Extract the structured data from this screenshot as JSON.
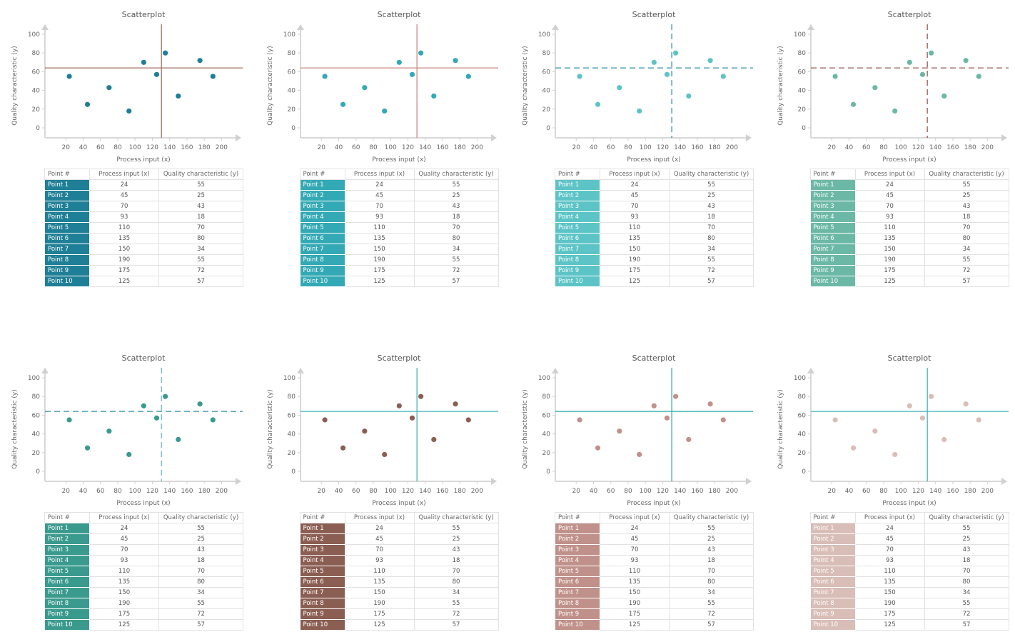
{
  "chart_data": [
    {
      "type": "scatter",
      "title": "Scatterplot",
      "xlabel": "Process input (x)",
      "ylabel": "Quality characteristic (y)",
      "xlim": [
        0,
        220
      ],
      "ylim": [
        -10,
        110
      ],
      "xticks": [
        20,
        40,
        60,
        80,
        100,
        120,
        140,
        160,
        180,
        200
      ],
      "yticks": [
        0,
        20,
        40,
        60,
        80,
        100
      ],
      "reference_lines": {
        "x": 130.5,
        "y": 64,
        "style": "solid"
      },
      "colors": {
        "point": "#1f7f96",
        "line": "#a07060"
      },
      "points": [
        {
          "name": "Point 1",
          "x": 24,
          "y": 55
        },
        {
          "name": "Point 2",
          "x": 45,
          "y": 25
        },
        {
          "name": "Point 3",
          "x": 70,
          "y": 43
        },
        {
          "name": "Point 4",
          "x": 93,
          "y": 18
        },
        {
          "name": "Point 5",
          "x": 110,
          "y": 70
        },
        {
          "name": "Point 6",
          "x": 135,
          "y": 80
        },
        {
          "name": "Point 7",
          "x": 150,
          "y": 34
        },
        {
          "name": "Point 8",
          "x": 190,
          "y": 55
        },
        {
          "name": "Point 9",
          "x": 175,
          "y": 72
        },
        {
          "name": "Point 10",
          "x": 125,
          "y": 57
        }
      ]
    },
    {
      "type": "scatter",
      "title": "Scatterplot",
      "xlabel": "Process input (x)",
      "ylabel": "Quality characteristic (y)",
      "xlim": [
        0,
        220
      ],
      "ylim": [
        -10,
        110
      ],
      "xticks": [
        20,
        40,
        60,
        80,
        100,
        120,
        140,
        160,
        180,
        200
      ],
      "yticks": [
        0,
        20,
        40,
        60,
        80,
        100
      ],
      "reference_lines": {
        "x": 130.5,
        "y": 64,
        "style": "solid"
      },
      "colors": {
        "point": "#33a9b5",
        "line": "#c98a80"
      },
      "points": [
        {
          "name": "Point 1",
          "x": 24,
          "y": 55
        },
        {
          "name": "Point 2",
          "x": 45,
          "y": 25
        },
        {
          "name": "Point 3",
          "x": 70,
          "y": 43
        },
        {
          "name": "Point 4",
          "x": 93,
          "y": 18
        },
        {
          "name": "Point 5",
          "x": 110,
          "y": 70
        },
        {
          "name": "Point 6",
          "x": 135,
          "y": 80
        },
        {
          "name": "Point 7",
          "x": 150,
          "y": 34
        },
        {
          "name": "Point 8",
          "x": 190,
          "y": 55
        },
        {
          "name": "Point 9",
          "x": 175,
          "y": 72
        },
        {
          "name": "Point 10",
          "x": 125,
          "y": 57
        }
      ]
    },
    {
      "type": "scatter",
      "title": "Scatterplot",
      "xlabel": "Process input (x)",
      "ylabel": "Quality characteristic (y)",
      "xlim": [
        0,
        220
      ],
      "ylim": [
        -10,
        110
      ],
      "xticks": [
        20,
        40,
        60,
        80,
        100,
        120,
        140,
        160,
        180,
        200
      ],
      "yticks": [
        0,
        20,
        40,
        60,
        80,
        100
      ],
      "reference_lines": {
        "x": 130.5,
        "y": 64,
        "style": "dashed"
      },
      "colors": {
        "point": "#5cc4c6",
        "line": "#2f8fa8"
      },
      "points": [
        {
          "name": "Point 1",
          "x": 24,
          "y": 55
        },
        {
          "name": "Point 2",
          "x": 45,
          "y": 25
        },
        {
          "name": "Point 3",
          "x": 70,
          "y": 43
        },
        {
          "name": "Point 4",
          "x": 93,
          "y": 18
        },
        {
          "name": "Point 5",
          "x": 110,
          "y": 70
        },
        {
          "name": "Point 6",
          "x": 135,
          "y": 80
        },
        {
          "name": "Point 7",
          "x": 150,
          "y": 34
        },
        {
          "name": "Point 8",
          "x": 190,
          "y": 55
        },
        {
          "name": "Point 9",
          "x": 175,
          "y": 72
        },
        {
          "name": "Point 10",
          "x": 125,
          "y": 57
        }
      ]
    },
    {
      "type": "scatter",
      "title": "Scatterplot",
      "xlabel": "Process input (x)",
      "ylabel": "Quality characteristic (y)",
      "xlim": [
        0,
        220
      ],
      "ylim": [
        -10,
        110
      ],
      "xticks": [
        20,
        40,
        60,
        80,
        100,
        120,
        140,
        160,
        180,
        200
      ],
      "yticks": [
        0,
        20,
        40,
        60,
        80,
        100
      ],
      "reference_lines": {
        "x": 130.5,
        "y": 64,
        "style": "dashed"
      },
      "colors": {
        "point": "#6cb8a6",
        "line": "#9a5a4e"
      },
      "points": [
        {
          "name": "Point 1",
          "x": 24,
          "y": 55
        },
        {
          "name": "Point 2",
          "x": 45,
          "y": 25
        },
        {
          "name": "Point 3",
          "x": 70,
          "y": 43
        },
        {
          "name": "Point 4",
          "x": 93,
          "y": 18
        },
        {
          "name": "Point 5",
          "x": 110,
          "y": 70
        },
        {
          "name": "Point 6",
          "x": 135,
          "y": 80
        },
        {
          "name": "Point 7",
          "x": 150,
          "y": 34
        },
        {
          "name": "Point 8",
          "x": 190,
          "y": 55
        },
        {
          "name": "Point 9",
          "x": 175,
          "y": 72
        },
        {
          "name": "Point 10",
          "x": 125,
          "y": 57
        }
      ]
    },
    {
      "type": "scatter",
      "title": "Scatterplot",
      "xlabel": "Process input (x)",
      "ylabel": "Quality characteristic (y)",
      "xlim": [
        0,
        220
      ],
      "ylim": [
        -10,
        110
      ],
      "xticks": [
        20,
        40,
        60,
        80,
        100,
        120,
        140,
        160,
        180,
        200
      ],
      "yticks": [
        0,
        20,
        40,
        60,
        80,
        100
      ],
      "reference_lines": {
        "x": 130.5,
        "y": 64,
        "style": "dashed"
      },
      "colors": {
        "point": "#3a9a8e",
        "line": "#2f8fa8",
        "xline": "#6ab6c4"
      },
      "points": [
        {
          "name": "Point 1",
          "x": 24,
          "y": 55
        },
        {
          "name": "Point 2",
          "x": 45,
          "y": 25
        },
        {
          "name": "Point 3",
          "x": 70,
          "y": 43
        },
        {
          "name": "Point 4",
          "x": 93,
          "y": 18
        },
        {
          "name": "Point 5",
          "x": 110,
          "y": 70
        },
        {
          "name": "Point 6",
          "x": 135,
          "y": 80
        },
        {
          "name": "Point 7",
          "x": 150,
          "y": 34
        },
        {
          "name": "Point 8",
          "x": 190,
          "y": 55
        },
        {
          "name": "Point 9",
          "x": 175,
          "y": 72
        },
        {
          "name": "Point 10",
          "x": 125,
          "y": 57
        }
      ]
    },
    {
      "type": "scatter",
      "title": "Scatterplot",
      "xlabel": "Process input (x)",
      "ylabel": "Quality characteristic (y)",
      "xlim": [
        0,
        220
      ],
      "ylim": [
        -10,
        110
      ],
      "xticks": [
        20,
        40,
        60,
        80,
        100,
        120,
        140,
        160,
        180,
        200
      ],
      "yticks": [
        0,
        20,
        40,
        60,
        80,
        100
      ],
      "reference_lines": {
        "x": 130.5,
        "y": 64,
        "style": "solid"
      },
      "colors": {
        "point": "#8b5e53",
        "line": "#45b5b8"
      },
      "points": [
        {
          "name": "Point 1",
          "x": 24,
          "y": 55
        },
        {
          "name": "Point 2",
          "x": 45,
          "y": 25
        },
        {
          "name": "Point 3",
          "x": 70,
          "y": 43
        },
        {
          "name": "Point 4",
          "x": 93,
          "y": 18
        },
        {
          "name": "Point 5",
          "x": 110,
          "y": 70
        },
        {
          "name": "Point 6",
          "x": 135,
          "y": 80
        },
        {
          "name": "Point 7",
          "x": 150,
          "y": 34
        },
        {
          "name": "Point 8",
          "x": 190,
          "y": 55
        },
        {
          "name": "Point 9",
          "x": 175,
          "y": 72
        },
        {
          "name": "Point 10",
          "x": 125,
          "y": 57
        }
      ]
    },
    {
      "type": "scatter",
      "title": "Scatterplot",
      "xlabel": "Process input (x)",
      "ylabel": "Quality characteristic (y)",
      "xlim": [
        0,
        220
      ],
      "ylim": [
        -10,
        110
      ],
      "xticks": [
        20,
        40,
        60,
        80,
        100,
        120,
        140,
        160,
        180,
        200
      ],
      "yticks": [
        0,
        20,
        40,
        60,
        80,
        100
      ],
      "reference_lines": {
        "x": 130.5,
        "y": 64,
        "style": "solid"
      },
      "colors": {
        "point": "#c0918a",
        "line": "#2fa8a8"
      },
      "points": [
        {
          "name": "Point 1",
          "x": 24,
          "y": 55
        },
        {
          "name": "Point 2",
          "x": 45,
          "y": 25
        },
        {
          "name": "Point 3",
          "x": 70,
          "y": 43
        },
        {
          "name": "Point 4",
          "x": 93,
          "y": 18
        },
        {
          "name": "Point 5",
          "x": 110,
          "y": 70
        },
        {
          "name": "Point 6",
          "x": 135,
          "y": 80
        },
        {
          "name": "Point 7",
          "x": 150,
          "y": 34
        },
        {
          "name": "Point 8",
          "x": 190,
          "y": 55
        },
        {
          "name": "Point 9",
          "x": 175,
          "y": 72
        },
        {
          "name": "Point 10",
          "x": 125,
          "y": 57
        }
      ]
    },
    {
      "type": "scatter",
      "title": "Scatterplot",
      "xlabel": "Process input (x)",
      "ylabel": "Quality characteristic (y)",
      "xlim": [
        0,
        220
      ],
      "ylim": [
        -10,
        110
      ],
      "xticks": [
        20,
        40,
        60,
        80,
        100,
        120,
        140,
        160,
        180,
        200
      ],
      "yticks": [
        0,
        20,
        40,
        60,
        80,
        100
      ],
      "reference_lines": {
        "x": 130.5,
        "y": 64,
        "style": "solid"
      },
      "colors": {
        "point": "#d9bdb7",
        "line": "#45b5b8"
      },
      "points": [
        {
          "name": "Point 1",
          "x": 24,
          "y": 55
        },
        {
          "name": "Point 2",
          "x": 45,
          "y": 25
        },
        {
          "name": "Point 3",
          "x": 70,
          "y": 43
        },
        {
          "name": "Point 4",
          "x": 93,
          "y": 18
        },
        {
          "name": "Point 5",
          "x": 110,
          "y": 70
        },
        {
          "name": "Point 6",
          "x": 135,
          "y": 80
        },
        {
          "name": "Point 7",
          "x": 150,
          "y": 34
        },
        {
          "name": "Point 8",
          "x": 190,
          "y": 55
        },
        {
          "name": "Point 9",
          "x": 175,
          "y": 72
        },
        {
          "name": "Point 10",
          "x": 125,
          "y": 57
        }
      ]
    }
  ],
  "table": {
    "headers": [
      "Point #",
      "Process input (x)",
      "Quality characteristic (y)"
    ],
    "rows": [
      [
        "Point 1",
        "24",
        "55"
      ],
      [
        "Point 2",
        "45",
        "25"
      ],
      [
        "Point 3",
        "70",
        "43"
      ],
      [
        "Point 4",
        "93",
        "18"
      ],
      [
        "Point 5",
        "110",
        "70"
      ],
      [
        "Point 6",
        "135",
        "80"
      ],
      [
        "Point 7",
        "150",
        "34"
      ],
      [
        "Point 8",
        "190",
        "55"
      ],
      [
        "Point 9",
        "175",
        "72"
      ],
      [
        "Point 10",
        "125",
        "57"
      ]
    ],
    "label_colors": [
      "#1f7f96",
      "#33a9b5",
      "#5cc4c6",
      "#6cb8a6",
      "#3a9a8e",
      "#8b5e53",
      "#c0918a",
      "#d9bdb7"
    ]
  }
}
